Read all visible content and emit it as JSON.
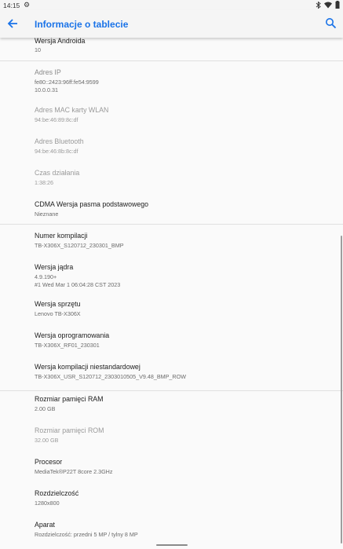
{
  "status": {
    "time": "14:15",
    "gear_icon": "gear-icon",
    "bluetooth_icon": "bluetooth-icon",
    "wifi_icon": "wifi-icon",
    "battery_icon": "battery-icon"
  },
  "appbar": {
    "title": "Informacje o tablecie",
    "back_icon": "arrow-back-icon",
    "search_icon": "search-icon"
  },
  "items": [
    {
      "title": "Wersja Androida",
      "sub": "10"
    },
    {
      "title": "Adres IP",
      "sub": "fe80::2423:96ff:fe54:9599",
      "sub2": "10.0.0.31"
    },
    {
      "title": "Adres MAC karty WLAN",
      "sub": "94:be:46:89:8c:df"
    },
    {
      "title": "Adres Bluetooth",
      "sub": "94:be:46:8b:8c:df"
    },
    {
      "title": "Czas działania",
      "sub": "1:38:26"
    },
    {
      "title": "CDMA Wersja pasma podstawowego",
      "sub": "Nieznane"
    },
    {
      "title": "Numer kompilacji",
      "sub": "TB-X306X_S120712_230301_BMP"
    },
    {
      "title": "Wersja jądra",
      "sub": "4.9.190+",
      "sub2": "#1 Wed Mar 1 06:04:28 CST 2023"
    },
    {
      "title": "Wersja sprzętu",
      "sub": "Lenovo TB-X306X"
    },
    {
      "title": "Wersja oprogramowania",
      "sub": "TB-X306X_RF01_230301"
    },
    {
      "title": "Wersja kompilacji niestandardowej",
      "sub": "TB-X306X_USR_S120712_2303010505_V9.48_BMP_ROW"
    },
    {
      "title": "Rozmiar pamięci RAM",
      "sub": "2.00 GB"
    },
    {
      "title": "Rozmiar pamięci ROM",
      "sub": "32.00 GB"
    },
    {
      "title": "Procesor",
      "sub": "MediaTek®P22T 8core 2.3GHz"
    },
    {
      "title": "Rozdzielczość",
      "sub": "1280x800"
    },
    {
      "title": "Aparat",
      "sub": "Rozdzielczość: przedni 5 MP / tylny 8 MP"
    }
  ]
}
